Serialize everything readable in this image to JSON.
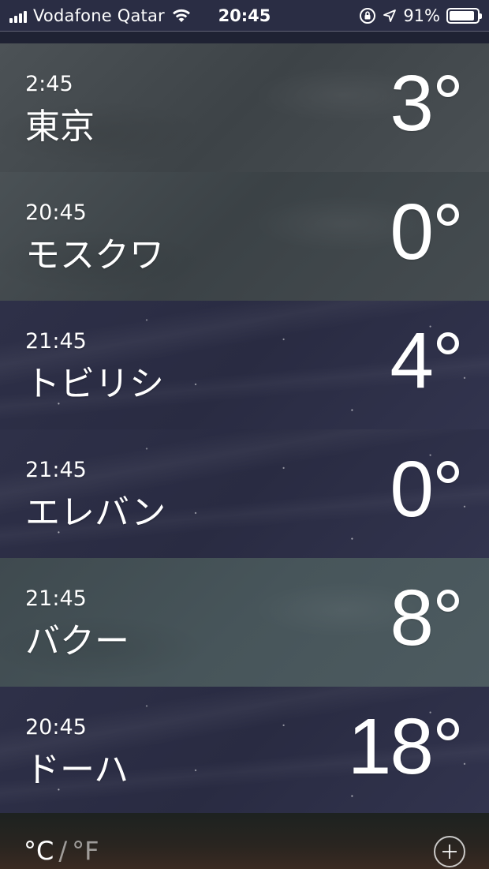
{
  "status_bar": {
    "carrier": "Vodafone Qatar",
    "time": "20:45",
    "battery_percent": "91%",
    "battery_level": 0.91,
    "icons": [
      "signal-icon",
      "wifi-icon",
      "rotation-lock-icon",
      "location-arrow-icon",
      "battery-icon"
    ]
  },
  "cities": [
    {
      "time": "2:45",
      "name": "東京",
      "temp": "3°",
      "style": "tokyo"
    },
    {
      "time": "20:45",
      "name": "モスクワ",
      "temp": "0°",
      "style": "cloudy"
    },
    {
      "time": "21:45",
      "name": "トビリシ",
      "temp": "4°",
      "style": "night"
    },
    {
      "time": "21:45",
      "name": "エレバン",
      "temp": "0°",
      "style": "night"
    },
    {
      "time": "21:45",
      "name": "バクー",
      "temp": "8°",
      "style": "overcast"
    },
    {
      "time": "20:45",
      "name": "ドーハ",
      "temp": "18°",
      "style": "night"
    }
  ],
  "footer": {
    "unit_c": "°C",
    "unit_separator": "/",
    "unit_f": "°F",
    "add_icon": "plus-circle-icon"
  }
}
